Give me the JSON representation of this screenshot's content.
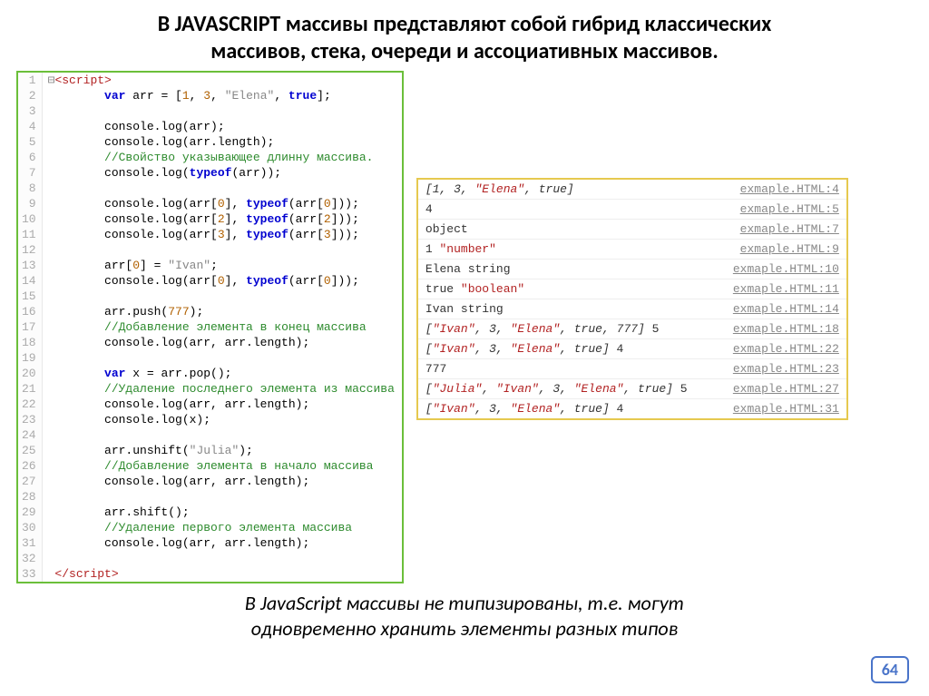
{
  "title_line1": "В JAVASCRIPT массивы представляют собой гибрид классических",
  "title_line2": "массивов, стека, очереди и ассоциативных массивов.",
  "code": {
    "lines": [
      {
        "n": "1",
        "html": "<span class='fold'>⊟</span><span class='tag'>&lt;script&gt;</span>"
      },
      {
        "n": "2",
        "html": "        <span class='kw'>var</span> arr = [<span class='num'>1</span>, <span class='num'>3</span>, <span class='str'>\"Elena\"</span>, <span class='bool'>true</span>];"
      },
      {
        "n": "3",
        "html": ""
      },
      {
        "n": "4",
        "html": "        console.log(arr);"
      },
      {
        "n": "5",
        "html": "        console.log(arr.length);"
      },
      {
        "n": "6",
        "html": "        <span class='cmt'>//Свойство указывающее длинну массива.</span>"
      },
      {
        "n": "7",
        "html": "        console.log(<span class='kw'>typeof</span>(arr));"
      },
      {
        "n": "8",
        "html": ""
      },
      {
        "n": "9",
        "html": "        console.log(arr[<span class='num'>0</span>], <span class='kw'>typeof</span>(arr[<span class='num'>0</span>]));"
      },
      {
        "n": "10",
        "html": "        console.log(arr[<span class='num'>2</span>], <span class='kw'>typeof</span>(arr[<span class='num'>2</span>]));"
      },
      {
        "n": "11",
        "html": "        console.log(arr[<span class='num'>3</span>], <span class='kw'>typeof</span>(arr[<span class='num'>3</span>]));"
      },
      {
        "n": "12",
        "html": ""
      },
      {
        "n": "13",
        "html": "        arr[<span class='num'>0</span>] = <span class='str'>\"Ivan\"</span>;"
      },
      {
        "n": "14",
        "html": "        console.log(arr[<span class='num'>0</span>], <span class='kw'>typeof</span>(arr[<span class='num'>0</span>]));"
      },
      {
        "n": "15",
        "html": ""
      },
      {
        "n": "16",
        "html": "        arr.push(<span class='num'>777</span>);"
      },
      {
        "n": "17",
        "html": "        <span class='cmt'>//Добавление элемента в конец массива</span>"
      },
      {
        "n": "18",
        "html": "        console.log(arr, arr.length);"
      },
      {
        "n": "19",
        "html": ""
      },
      {
        "n": "20",
        "html": "        <span class='kw'>var</span> x = arr.pop();"
      },
      {
        "n": "21",
        "html": "        <span class='cmt'>//Удаление последнего элемента из массива</span>"
      },
      {
        "n": "22",
        "html": "        console.log(arr, arr.length);"
      },
      {
        "n": "23",
        "html": "        console.log(x);"
      },
      {
        "n": "24",
        "html": ""
      },
      {
        "n": "25",
        "html": "        arr.unshift(<span class='str'>\"Julia\"</span>);"
      },
      {
        "n": "26",
        "html": "        <span class='cmt'>//Добавление элемента в начало массива</span>"
      },
      {
        "n": "27",
        "html": "        console.log(arr, arr.length);"
      },
      {
        "n": "28",
        "html": ""
      },
      {
        "n": "29",
        "html": "        arr.shift();"
      },
      {
        "n": "30",
        "html": "        <span class='cmt'>//Удаление первого элемента массива</span>"
      },
      {
        "n": "31",
        "html": "        console.log(arr, arr.length);"
      },
      {
        "n": "32",
        "html": ""
      },
      {
        "n": "33",
        "html": " <span class='tag'>&lt;/script&gt;</span>"
      }
    ]
  },
  "console": {
    "rows": [
      {
        "out": "<span class='ci'>[1, 3, <span class='cstr'>\"Elena\"</span>, true]</span>",
        "loc": "exmaple.HTML:4"
      },
      {
        "out": "4",
        "loc": "exmaple.HTML:5"
      },
      {
        "out": "object",
        "loc": "exmaple.HTML:7"
      },
      {
        "out": "1 <span class='cstr'>\"number\"</span>",
        "loc": "exmaple.HTML:9"
      },
      {
        "out": "Elena string",
        "loc": "exmaple.HTML:10"
      },
      {
        "out": "true <span class='cstr'>\"boolean\"</span>",
        "loc": "exmaple.HTML:11"
      },
      {
        "out": "Ivan string",
        "loc": "exmaple.HTML:14"
      },
      {
        "out": "<span class='ci'>[<span class='cstr'>\"Ivan\"</span>, 3, <span class='cstr'>\"Elena\"</span>, true, 777]</span> 5",
        "loc": "exmaple.HTML:18"
      },
      {
        "out": "<span class='ci'>[<span class='cstr'>\"Ivan\"</span>, 3, <span class='cstr'>\"Elena\"</span>, true]</span> 4",
        "loc": "exmaple.HTML:22"
      },
      {
        "out": "777",
        "loc": "exmaple.HTML:23"
      },
      {
        "out": "<span class='ci'>[<span class='cstr'>\"Julia\"</span>, <span class='cstr'>\"Ivan\"</span>, 3, <span class='cstr'>\"Elena\"</span>, true]</span> 5",
        "loc": "exmaple.HTML:27"
      },
      {
        "out": "<span class='ci'>[<span class='cstr'>\"Ivan\"</span>, 3, <span class='cstr'>\"Elena\"</span>, true]</span> 4",
        "loc": "exmaple.HTML:31"
      }
    ]
  },
  "footer_line1": "В JavaScript массивы не типизированы, т.е. могут",
  "footer_line2": "одновременно хранить элементы разных типов",
  "slide_number": "64"
}
